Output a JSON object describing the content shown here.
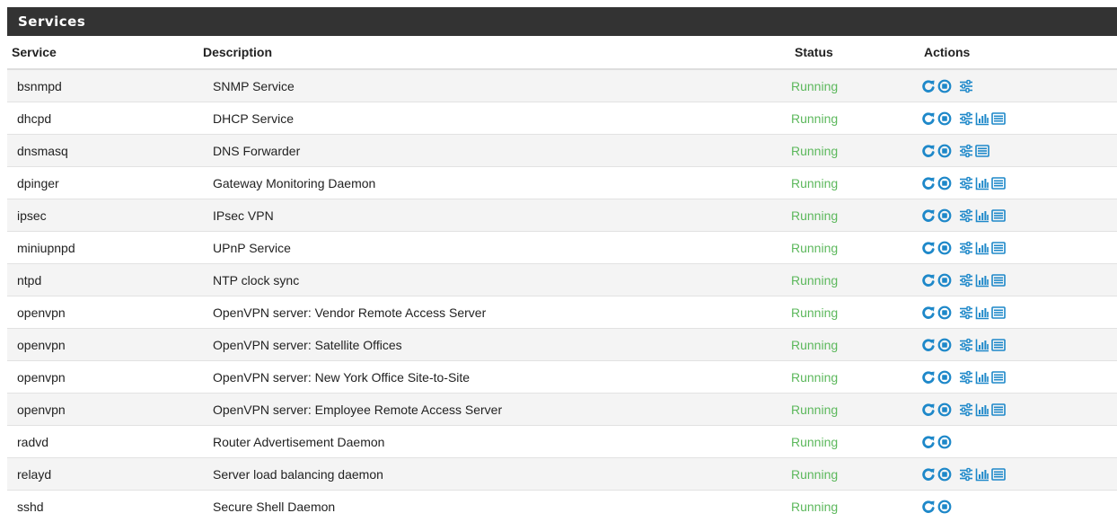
{
  "panel": {
    "title": "Services"
  },
  "columns": {
    "service": "Service",
    "description": "Description",
    "status": "Status",
    "actions": "Actions"
  },
  "colors": {
    "status_running": "#5cb85c",
    "icon": "#1e88c9",
    "header_bg": "#333333"
  },
  "icons": {
    "restart": "restart-icon",
    "stop": "stop-icon",
    "settings": "settings-sliders-icon",
    "status": "bar-chart-icon",
    "logs": "log-list-icon"
  },
  "rows": [
    {
      "service": "bsnmpd",
      "description": "SNMP Service",
      "status": "Running",
      "actions": [
        "restart",
        "stop",
        "settings"
      ]
    },
    {
      "service": "dhcpd",
      "description": "DHCP Service",
      "status": "Running",
      "actions": [
        "restart",
        "stop",
        "settings",
        "status",
        "logs"
      ]
    },
    {
      "service": "dnsmasq",
      "description": "DNS Forwarder",
      "status": "Running",
      "actions": [
        "restart",
        "stop",
        "settings",
        "logs"
      ]
    },
    {
      "service": "dpinger",
      "description": "Gateway Monitoring Daemon",
      "status": "Running",
      "actions": [
        "restart",
        "stop",
        "settings",
        "status",
        "logs"
      ]
    },
    {
      "service": "ipsec",
      "description": "IPsec VPN",
      "status": "Running",
      "actions": [
        "restart",
        "stop",
        "settings",
        "status",
        "logs"
      ]
    },
    {
      "service": "miniupnpd",
      "description": "UPnP Service",
      "status": "Running",
      "actions": [
        "restart",
        "stop",
        "settings",
        "status",
        "logs"
      ]
    },
    {
      "service": "ntpd",
      "description": "NTP clock sync",
      "status": "Running",
      "actions": [
        "restart",
        "stop",
        "settings",
        "status",
        "logs"
      ]
    },
    {
      "service": "openvpn",
      "description": "OpenVPN server: Vendor Remote Access Server",
      "status": "Running",
      "actions": [
        "restart",
        "stop",
        "settings",
        "status",
        "logs"
      ]
    },
    {
      "service": "openvpn",
      "description": "OpenVPN server: Satellite Offices",
      "status": "Running",
      "actions": [
        "restart",
        "stop",
        "settings",
        "status",
        "logs"
      ]
    },
    {
      "service": "openvpn",
      "description": "OpenVPN server: New York Office Site-to-Site",
      "status": "Running",
      "actions": [
        "restart",
        "stop",
        "settings",
        "status",
        "logs"
      ]
    },
    {
      "service": "openvpn",
      "description": "OpenVPN server: Employee Remote Access Server",
      "status": "Running",
      "actions": [
        "restart",
        "stop",
        "settings",
        "status",
        "logs"
      ]
    },
    {
      "service": "radvd",
      "description": "Router Advertisement Daemon",
      "status": "Running",
      "actions": [
        "restart",
        "stop"
      ]
    },
    {
      "service": "relayd",
      "description": "Server load balancing daemon",
      "status": "Running",
      "actions": [
        "restart",
        "stop",
        "settings",
        "status",
        "logs"
      ]
    },
    {
      "service": "sshd",
      "description": "Secure Shell Daemon",
      "status": "Running",
      "actions": [
        "restart",
        "stop"
      ]
    }
  ]
}
